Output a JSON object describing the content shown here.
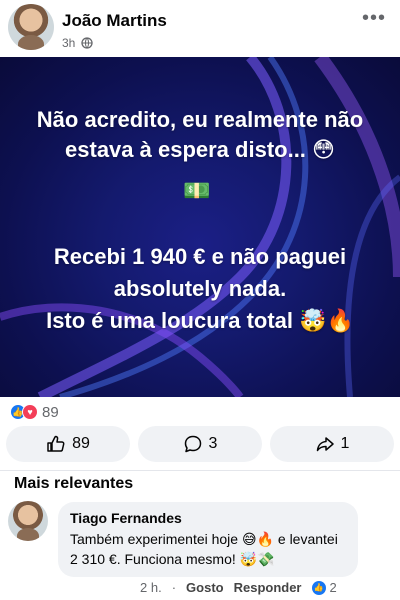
{
  "post": {
    "author": "João Martins",
    "time": "3h",
    "more_icon": "more-horizontal-icon",
    "image_lines": [
      "Não acredito, eu realmente não",
      "estava à espera disto... 😳",
      "💵",
      "Recebi 1 940 € e não paguei",
      "absolutely nada.",
      "Isto é uma loucura total 🤯🔥"
    ],
    "reaction_count": "89",
    "actions": {
      "like_count": "89",
      "comment_count": "3",
      "share_count": "1"
    }
  },
  "comments_section": {
    "title": "Mais relevantes",
    "comments": [
      {
        "name": "Tiago Fernandes",
        "text": "Também experimentei hoje 😅🔥 e levantei 2 310 €. Funciona mesmo! 🤯💸",
        "time": "2 h.",
        "like_label": "Gosto",
        "reply_label": "Responder",
        "reaction_count": "2"
      }
    ]
  },
  "colors": {
    "accent": "#1877f2",
    "love": "#f33e58",
    "bubble": "#f0f2f5",
    "muted_text": "#65676b",
    "image_bg": "#141a6e"
  }
}
